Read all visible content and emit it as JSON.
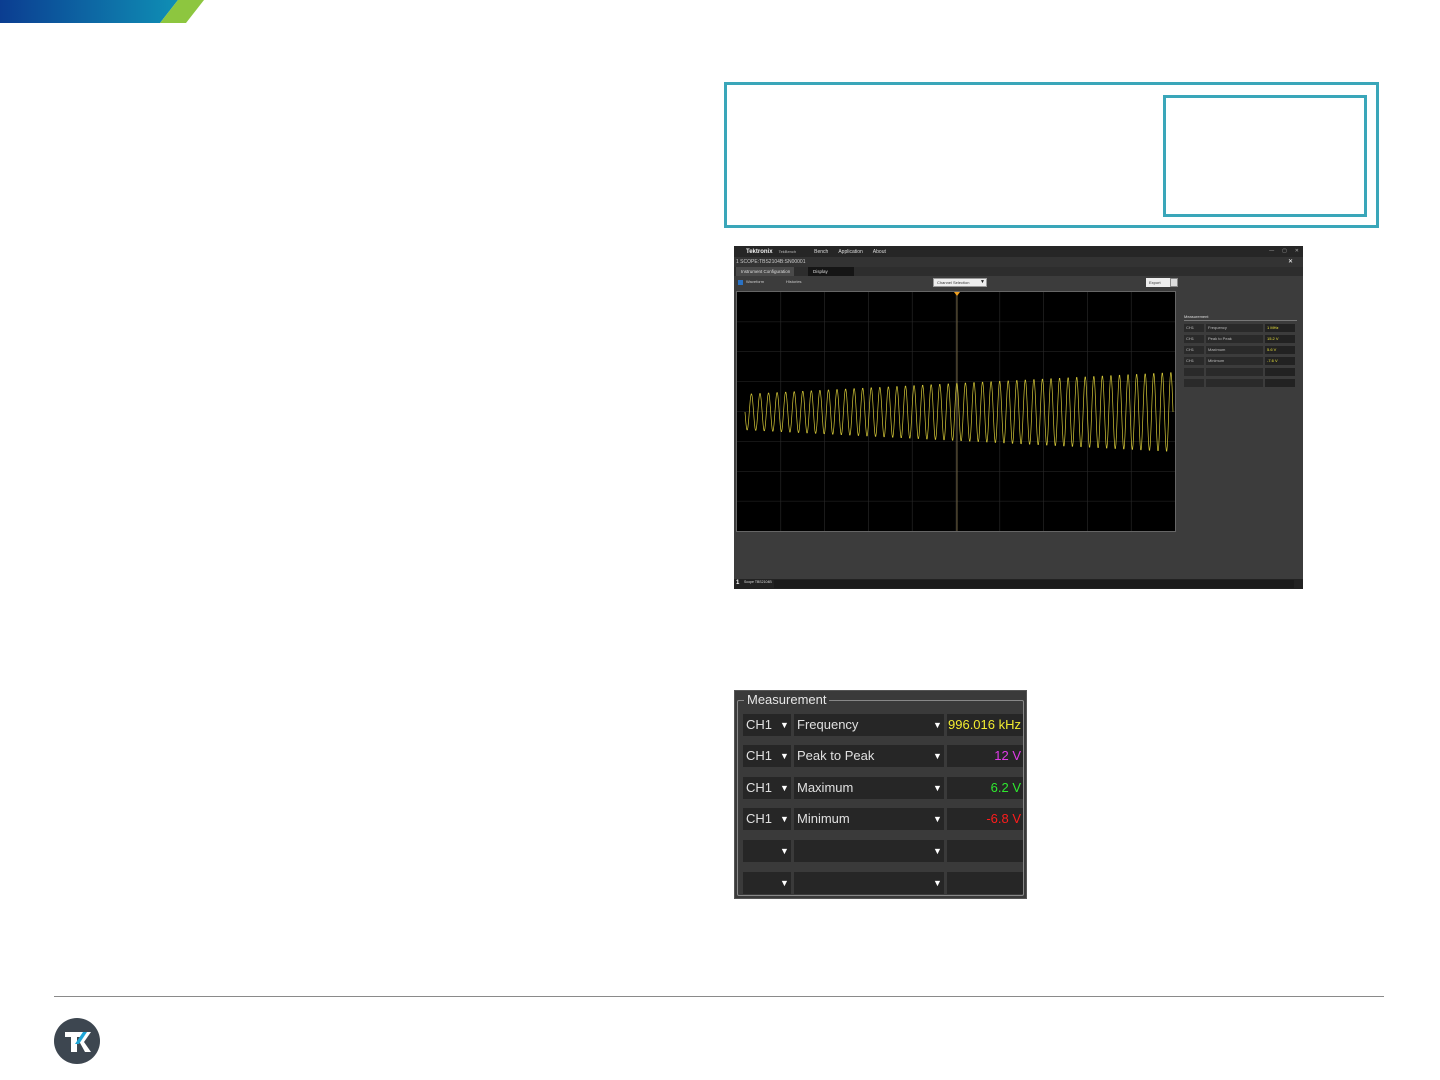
{
  "colors": {
    "brand_blue": "#0b3d91",
    "brand_teal": "#0f8fb5",
    "brand_green": "#8dc63f",
    "callout_border": "#3aa6b9",
    "trace_yellow": "#d6c938",
    "val_yellow": "#f2ec30",
    "val_magenta": "#e03be8",
    "val_green": "#2ee82e",
    "val_red": "#ff1c1c"
  },
  "app": {
    "logo": "Tektronix",
    "subtitle": "TekBench",
    "menu": [
      "Bench",
      "Application",
      "About"
    ],
    "window_controls": [
      "—",
      "▢",
      "✕"
    ],
    "scope_id": "1  SCOPE:TBS2104B:SN00001",
    "close_glyph": "✕",
    "tabs": [
      "Instrument Configuration",
      "Display"
    ],
    "toolbar": {
      "waveform_label": "Waveform",
      "history_label": "Histories",
      "channel_select": "Channel Selection",
      "export_label": "Export"
    },
    "mini_measurement": {
      "title": "Measurement",
      "rows": [
        {
          "ch": "CH1",
          "type": "Frequency",
          "value": "1 MHz"
        },
        {
          "ch": "CH1",
          "type": "Peak to Peak",
          "value": "15.2 V"
        },
        {
          "ch": "CH1",
          "type": "Maximum",
          "value": "5.6 V"
        },
        {
          "ch": "CH1",
          "type": "Minimum",
          "value": "-7.6 V"
        },
        {
          "ch": "",
          "type": "",
          "value": ""
        },
        {
          "ch": "",
          "type": "",
          "value": ""
        }
      ]
    },
    "bottom": {
      "index": "1",
      "model": "Scope TBS2104B"
    }
  },
  "measurement": {
    "title": "Measurement",
    "rows": [
      {
        "ch": "CH1",
        "type": "Frequency",
        "value": "996.016 kHz",
        "color": "#f2ec30"
      },
      {
        "ch": "CH1",
        "type": "Peak to Peak",
        "value": "12 V",
        "color": "#e03be8"
      },
      {
        "ch": "CH1",
        "type": "Maximum",
        "value": "6.2 V",
        "color": "#2ee82e"
      },
      {
        "ch": "CH1",
        "type": "Minimum",
        "value": "-6.8 V",
        "color": "#ff1c1c"
      },
      {
        "ch": "",
        "type": "",
        "value": "",
        "color": "#ffffff"
      },
      {
        "ch": "",
        "type": "",
        "value": "",
        "color": "#ffffff"
      }
    ]
  },
  "icons": {
    "dropdown": "chevron-down-icon",
    "footer_logo": "tek-logo-icon"
  }
}
